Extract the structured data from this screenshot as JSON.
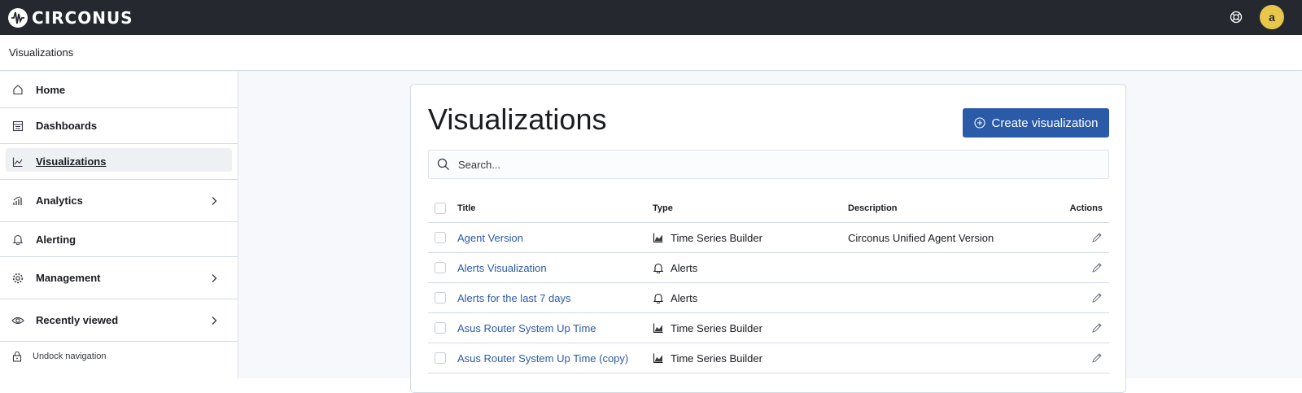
{
  "app": {
    "brand": "CIRCONUS",
    "avatar_initial": "a",
    "accent": "#2b5aa8",
    "topbar_color": "#25282f"
  },
  "breadcrumb": "Visualizations",
  "sidebar": {
    "items": [
      {
        "label": "Home",
        "icon": "home-icon"
      },
      {
        "label": "Dashboards",
        "icon": "dashboard-icon"
      },
      {
        "label": "Visualizations",
        "icon": "visualize-icon",
        "active": true
      },
      {
        "label": "Analytics",
        "icon": "analytics-icon",
        "chevron": true
      },
      {
        "label": "Alerting",
        "icon": "bell-icon"
      },
      {
        "label": "Management",
        "icon": "gear-icon",
        "chevron": true
      },
      {
        "label": "Recently viewed",
        "icon": "eye-icon",
        "chevron": true
      }
    ],
    "undock_label": "Undock navigation"
  },
  "main": {
    "title": "Visualizations",
    "create_label": "Create visualization",
    "search_placeholder": "Search...",
    "columns": {
      "title": "Title",
      "type": "Type",
      "description": "Description",
      "actions": "Actions"
    },
    "rows": [
      {
        "title": "Agent Version",
        "type": "Time Series Builder",
        "type_icon": "area-chart-icon",
        "description": "Circonus Unified Agent Version"
      },
      {
        "title": "Alerts Visualization",
        "type": "Alerts",
        "type_icon": "bell-icon",
        "description": ""
      },
      {
        "title": "Alerts for the last 7 days",
        "type": "Alerts",
        "type_icon": "bell-icon",
        "description": ""
      },
      {
        "title": "Asus Router System Up Time",
        "type": "Time Series Builder",
        "type_icon": "area-chart-icon",
        "description": ""
      },
      {
        "title": "Asus Router System Up Time (copy)",
        "type": "Time Series Builder",
        "type_icon": "area-chart-icon",
        "description": ""
      }
    ]
  }
}
